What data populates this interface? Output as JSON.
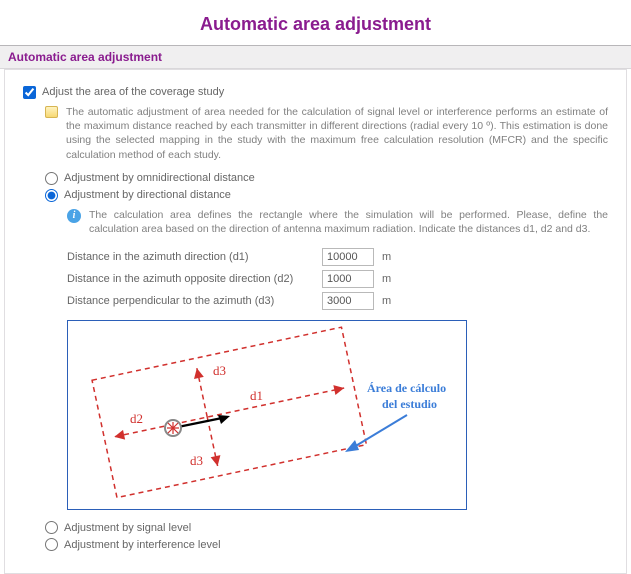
{
  "title": "Automatic area adjustment",
  "section_header": "Automatic area adjustment",
  "checkbox_label": "Adjust the area of the coverage study",
  "description": "The automatic adjustment of area needed for the calculation of signal level or interference performs an estimate of the maximum distance reached by each transmitter in different directions (radial every 10 º). This estimation is done using the selected mapping in the study with the maximum free calculation resolution (MFCR) and the specific calculation method of each study.",
  "radios": {
    "omni": "Adjustment by omnidirectional distance",
    "directional": "Adjustment by directional distance",
    "signal": "Adjustment by signal level",
    "interference": "Adjustment by interference level"
  },
  "directional_info": "The calculation area defines the rectangle where the simulation will be performed. Please, define the calculation area based on the direction of antenna maximum radiation. Indicate the distances d1, d2 and d3.",
  "fields": {
    "d1": {
      "label": "Distance in the azimuth direction (d1)",
      "value": "10000",
      "unit": "m"
    },
    "d2": {
      "label": "Distance in the azimuth opposite direction (d2)",
      "value": "1000",
      "unit": "m"
    },
    "d3": {
      "label": "Distance perpendicular to the azimuth (d3)",
      "value": "3000",
      "unit": "m"
    }
  },
  "diagram": {
    "d1": "d1",
    "d2": "d2",
    "d3": "d3",
    "area_label_1": "Área de cálculo",
    "area_label_2": "del estudio"
  }
}
